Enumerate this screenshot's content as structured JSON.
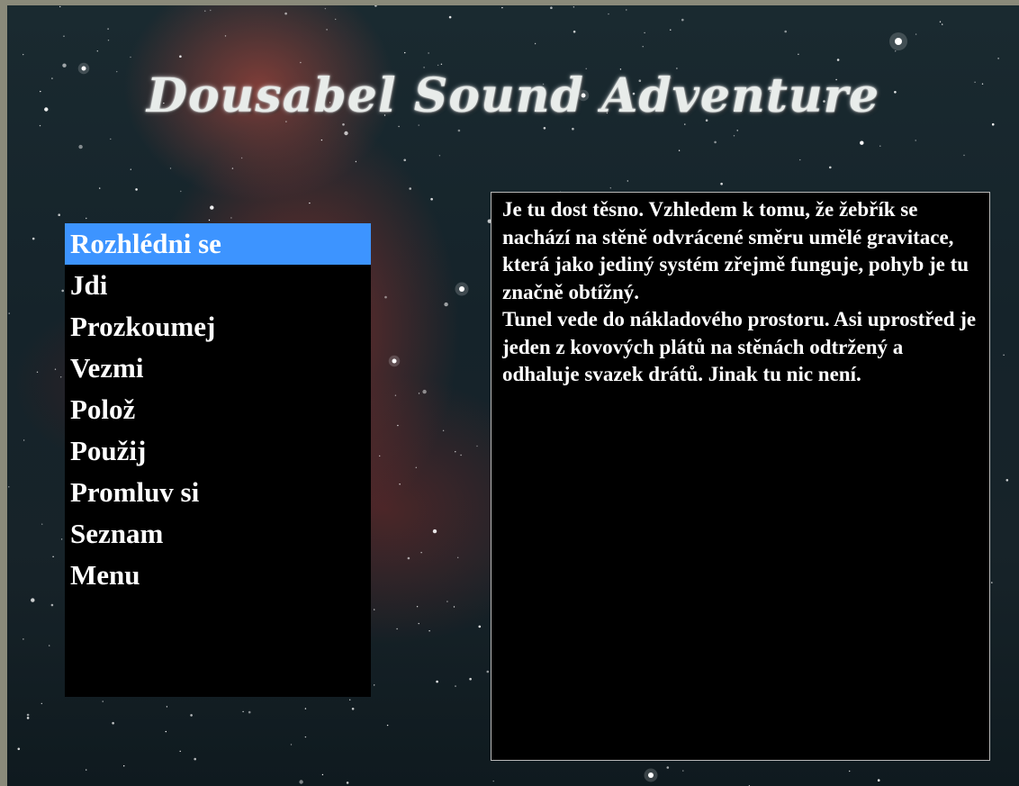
{
  "game": {
    "title": "Dousabel Sound Adventure"
  },
  "menu": {
    "selected_index": 0,
    "items": [
      {
        "label": "Rozhlédni se"
      },
      {
        "label": "Jdi"
      },
      {
        "label": "Prozkoumej"
      },
      {
        "label": "Vezmi"
      },
      {
        "label": "Polož"
      },
      {
        "label": "Použij"
      },
      {
        "label": "Promluv si"
      },
      {
        "label": "Seznam"
      },
      {
        "label": "Menu"
      }
    ]
  },
  "description": {
    "paragraphs": [
      "Je tu dost těsno. Vzhledem k tomu, že žebřík se nachází na stěně odvrácené směru umělé gravitace, která jako jediný systém zřejmě funguje, pohyb je tu značně obtížný.",
      "Tunel vede do nákladového prostoru. Asi uprostřed je jeden z kovových plátů na stěnách odtržený a odhaluje svazek drátů. Jinak tu nic není."
    ]
  },
  "colors": {
    "selection_highlight": "#3d94ff",
    "panel_background": "#000000",
    "text": "#ffffff",
    "panel_border": "#b8b8b8"
  }
}
